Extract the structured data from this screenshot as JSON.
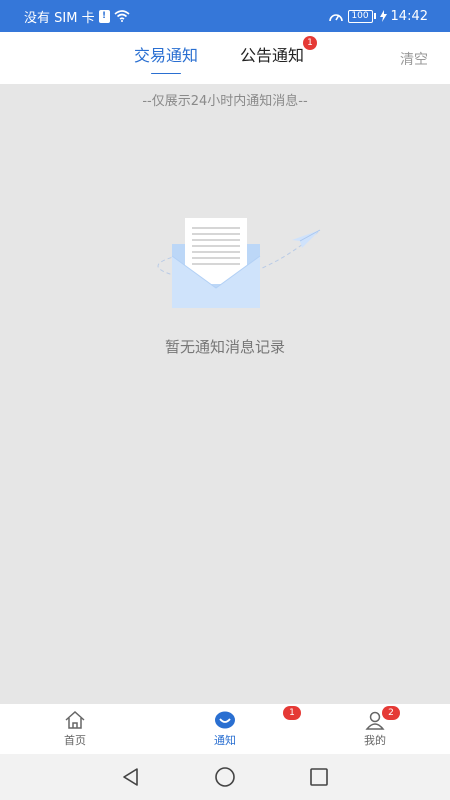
{
  "status_bar": {
    "carrier": "没有 SIM 卡",
    "sim_badge": "!",
    "battery": "100",
    "time": "14:42"
  },
  "tabs": [
    {
      "label": "交易通知",
      "active": true
    },
    {
      "label": "公告通知",
      "badge": "1",
      "active": false
    }
  ],
  "header": {
    "clear_label": "清空"
  },
  "content": {
    "hint": "--仅展示24小时内通知消息--",
    "empty_text": "暂无通知消息记录"
  },
  "bottom_nav": {
    "items": [
      {
        "label": "首页",
        "icon": "home-icon"
      },
      {
        "label": "通知",
        "icon": "notification-icon",
        "badge": "1",
        "active": true
      },
      {
        "label": "我的",
        "icon": "user-icon",
        "badge": "2"
      }
    ]
  },
  "colors": {
    "status_bar": "#3577d9",
    "accent": "#2a6fd1",
    "badge": "#e53935",
    "background": "#e6e6e6"
  }
}
